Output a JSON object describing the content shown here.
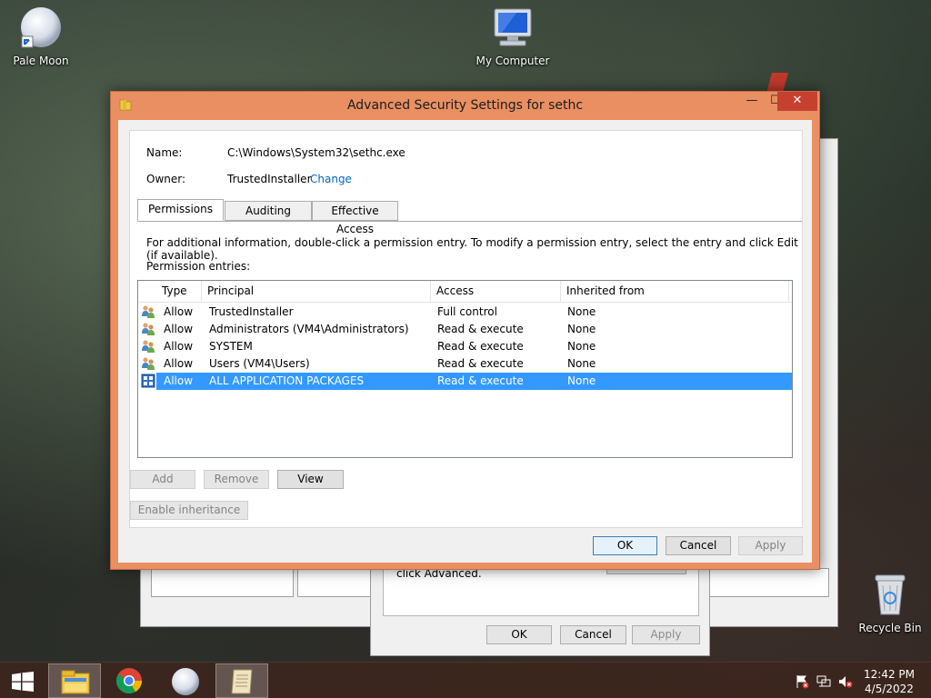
{
  "desktop": {
    "icons": {
      "pale_moon": "Pale Moon",
      "my_computer": "My Computer",
      "recycle_bin": "Recycle Bin"
    }
  },
  "background_dialog": {
    "text": "click Advanced.",
    "ok": "OK",
    "cancel": "Cancel",
    "apply": "Apply"
  },
  "dialog": {
    "title": "Advanced Security Settings for sethc",
    "minimize_glyph": "—",
    "maximize_glyph": "☐",
    "close_glyph": "✕",
    "name_label": "Name:",
    "name_value": "C:\\Windows\\System32\\sethc.exe",
    "owner_label": "Owner:",
    "owner_value": "TrustedInstaller",
    "change_link": "Change",
    "tabs": [
      "Permissions",
      "Auditing",
      "Effective Access"
    ],
    "instructions": "For additional information, double-click a permission entry. To modify a permission entry, select the entry and click Edit (if available).",
    "entries_label": "Permission entries:",
    "columns": [
      "Type",
      "Principal",
      "Access",
      "Inherited from"
    ],
    "rows": [
      {
        "type": "Allow",
        "principal": "TrustedInstaller",
        "access": "Full control",
        "inherited": "None",
        "icon": "users-icon"
      },
      {
        "type": "Allow",
        "principal": "Administrators (VM4\\Administrators)",
        "access": "Read & execute",
        "inherited": "None",
        "icon": "users-icon"
      },
      {
        "type": "Allow",
        "principal": "SYSTEM",
        "access": "Read & execute",
        "inherited": "None",
        "icon": "users-icon"
      },
      {
        "type": "Allow",
        "principal": "Users (VM4\\Users)",
        "access": "Read & execute",
        "inherited": "None",
        "icon": "users-icon"
      },
      {
        "type": "Allow",
        "principal": "ALL APPLICATION PACKAGES",
        "access": "Read & execute",
        "inherited": "None",
        "icon": "app-packages-icon"
      }
    ],
    "selected_row": 4,
    "buttons": {
      "add": "Add",
      "remove": "Remove",
      "view": "View",
      "enable_inheritance": "Enable inheritance",
      "ok": "OK",
      "cancel": "Cancel",
      "apply": "Apply"
    }
  },
  "taskbar": {
    "clock_time": "12:42 PM",
    "clock_date": "4/5/2022",
    "items": [
      "start-button",
      "file-explorer-icon",
      "chrome-icon",
      "pale-moon-icon",
      "notepad-icon"
    ]
  },
  "colors": {
    "dialog_frame": "#e98f62",
    "selection": "#3399ff",
    "link": "#0066cc",
    "close_button": "#c7402f"
  }
}
